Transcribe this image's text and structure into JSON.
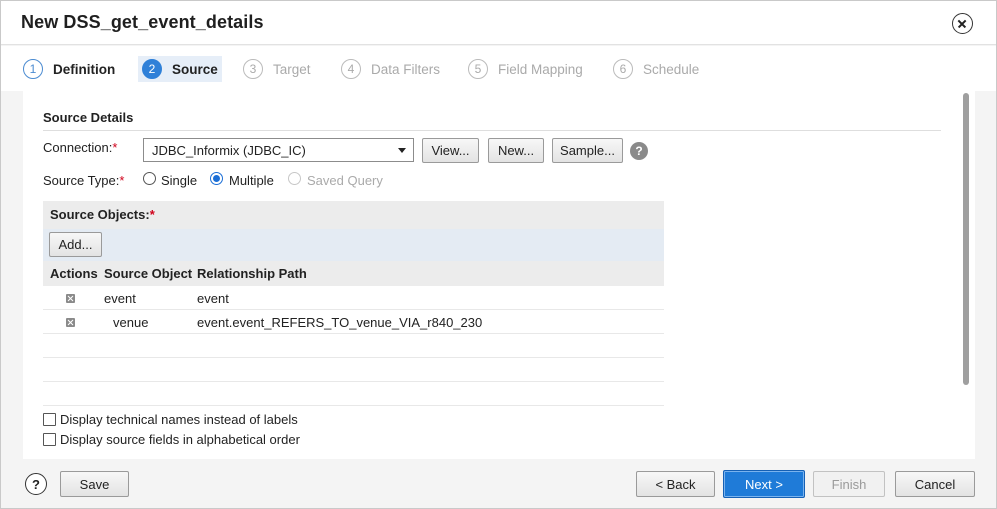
{
  "dialog": {
    "title": "New DSS_get_event_details"
  },
  "steps": [
    {
      "num": "1",
      "label": "Definition"
    },
    {
      "num": "2",
      "label": "Source"
    },
    {
      "num": "3",
      "label": "Target"
    },
    {
      "num": "4",
      "label": "Data Filters"
    },
    {
      "num": "5",
      "label": "Field Mapping"
    },
    {
      "num": "6",
      "label": "Schedule"
    }
  ],
  "source": {
    "section_title": "Source Details",
    "connection_label": "Connection:",
    "connection_value": "JDBC_Informix (JDBC_IC)",
    "view_button": "View...",
    "new_button": "New...",
    "sample_button": "Sample...",
    "help_glyph": "?",
    "required_mark": "*",
    "source_type_label": "Source Type:",
    "type_single": "Single",
    "type_multiple": "Multiple",
    "type_saved_query": "Saved Query",
    "source_objects_label": "Source Objects:",
    "add_button": "Add...",
    "columns": [
      "Actions",
      "Source Object",
      "Relationship Path"
    ],
    "rows": [
      {
        "object": "event",
        "path": "event"
      },
      {
        "object": "venue",
        "path": "event.event_REFERS_TO_venue_VIA_r840_230"
      }
    ],
    "opt_technical_names": "Display technical names instead of labels",
    "opt_alphabetical": "Display source fields in alphabetical order"
  },
  "footer": {
    "help_glyph": "?",
    "save": "Save",
    "back": "< Back",
    "next": "Next >",
    "finish": "Finish",
    "cancel": "Cancel"
  },
  "colors": {
    "accent": "#2f80d8",
    "required": "#d0021b"
  }
}
